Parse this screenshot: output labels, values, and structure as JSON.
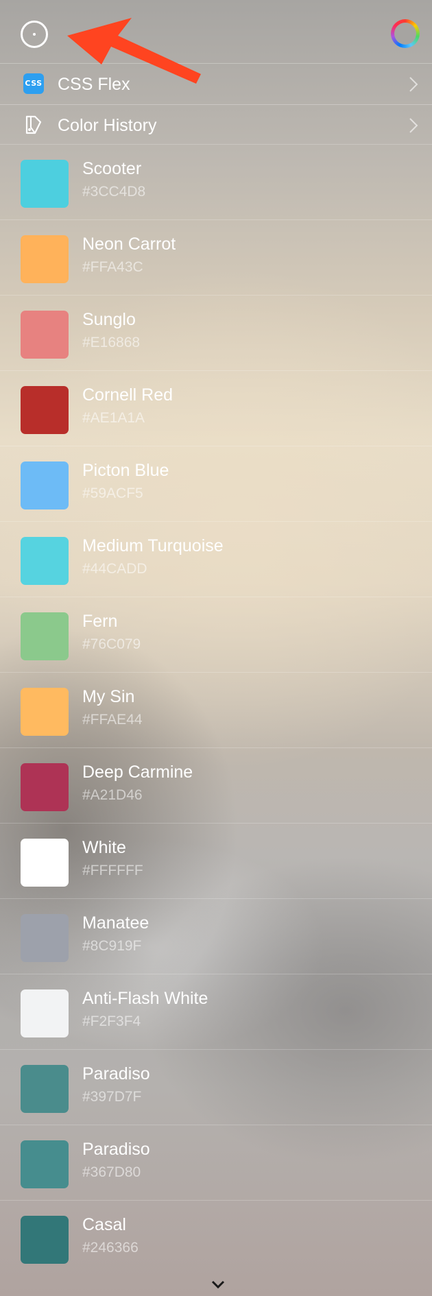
{
  "header": {
    "left_icon": "circle-dot-icon",
    "right_icon": "color-wheel-icon",
    "annotation_icon": "red-arrow-annotation-icon"
  },
  "nav": [
    {
      "icon": "css-icon",
      "icon_text": "CSS",
      "label": "CSS Flex",
      "chevron": "chevron-right-icon"
    },
    {
      "icon": "tag-icon",
      "label": "Color History",
      "chevron": "chevron-right-icon"
    }
  ],
  "colors": [
    {
      "name": "Scooter",
      "hex": "#3CC4D8",
      "color": "#4DCFDF"
    },
    {
      "name": "Neon Carrot",
      "hex": "#FFA43C",
      "color": "#FFB25A"
    },
    {
      "name": "Sunglo",
      "hex": "#E16868",
      "color": "#E78280"
    },
    {
      "name": "Cornell Red",
      "hex": "#AE1A1A",
      "color": "#B82E2A"
    },
    {
      "name": "Picton Blue",
      "hex": "#59ACF5",
      "color": "#6DBBF6"
    },
    {
      "name": "Medium Turquoise",
      "hex": "#44CADD",
      "color": "#56D3E0"
    },
    {
      "name": "Fern",
      "hex": "#76C079",
      "color": "#8BC98C"
    },
    {
      "name": "My Sin",
      "hex": "#FFAE44",
      "color": "#FFBA60"
    },
    {
      "name": "Deep Carmine",
      "hex": "#A21D46",
      "color": "#AE3355"
    },
    {
      "name": "White",
      "hex": "#FFFFFF",
      "color": "#FFFFFF"
    },
    {
      "name": "Manatee",
      "hex": "#8C919F",
      "color": "#9DA1AB"
    },
    {
      "name": "Anti-Flash White",
      "hex": "#F2F3F4",
      "color": "#F2F3F4"
    },
    {
      "name": "Paradiso",
      "hex": "#397D7F",
      "color": "#4A8C8C"
    },
    {
      "name": "Paradiso",
      "hex": "#367D80",
      "color": "#468D8E"
    },
    {
      "name": "Casal",
      "hex": "#246366",
      "color": "#327778"
    }
  ],
  "footer": {
    "more_icon": "chevron-down-icon"
  }
}
